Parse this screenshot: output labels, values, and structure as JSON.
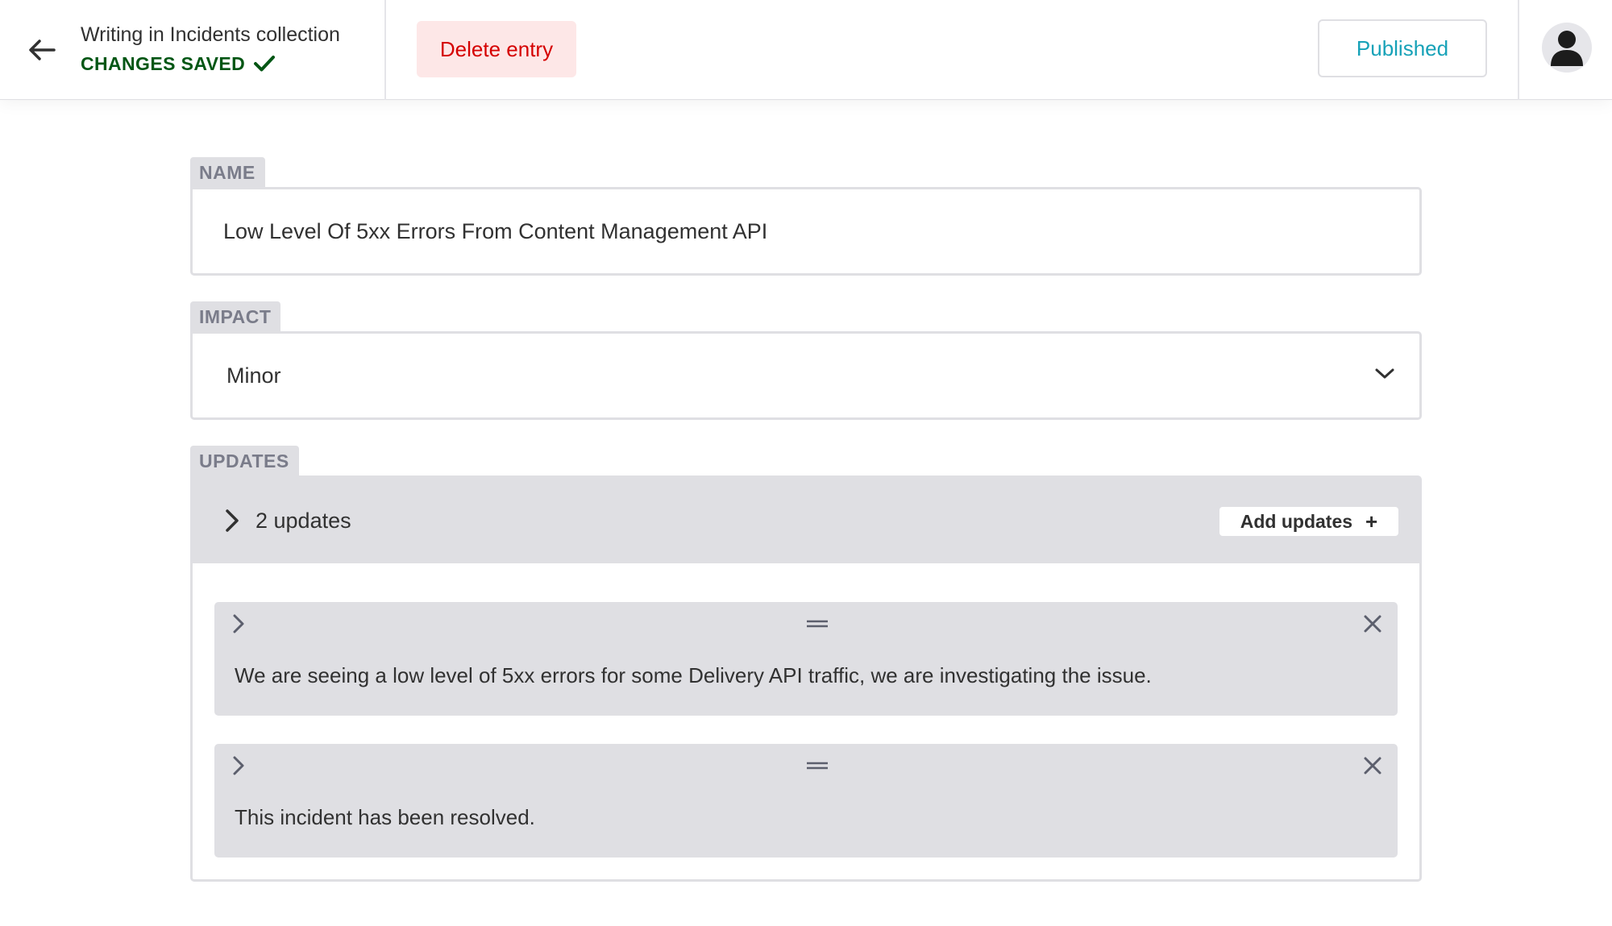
{
  "header": {
    "collection_title": "Writing in Incidents collection",
    "save_status": "CHANGES SAVED",
    "delete_label": "Delete entry",
    "status_label": "Published"
  },
  "fields": {
    "name": {
      "label": "NAME",
      "value": "Low Level Of 5xx Errors From Content Management API"
    },
    "impact": {
      "label": "IMPACT",
      "value": "Minor"
    },
    "updates": {
      "label": "UPDATES",
      "count_label": "2 updates",
      "add_label": "Add updates",
      "items": [
        {
          "text": "We are seeing a low level of 5xx errors for some Delivery API traffic, we are investigating the issue."
        },
        {
          "text": "This incident has been resolved."
        }
      ]
    }
  },
  "icons": {
    "back": "arrow-left-icon",
    "saved": "checkmark-icon",
    "user": "user-icon",
    "select": "chevron-down-icon",
    "expand": "chevron-right-icon",
    "drag": "drag-handle-icon",
    "remove": "close-icon",
    "add": "plus-icon"
  },
  "colors": {
    "saved_green": "#005614",
    "danger_red": "#d50000",
    "danger_bg": "#fde7e7",
    "published_teal": "#17a2b8",
    "panel_gray": "#dfdfe3",
    "label_gray": "#7a7c8a"
  }
}
